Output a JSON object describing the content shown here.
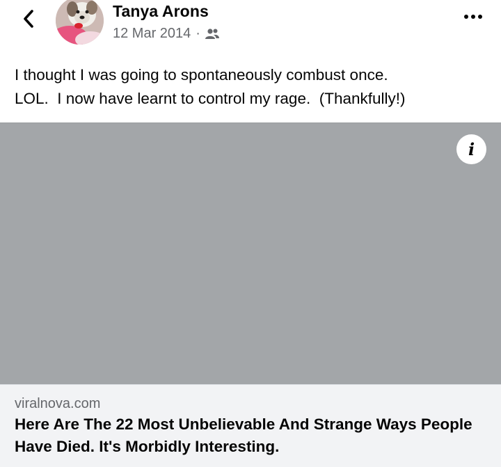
{
  "post": {
    "author": "Tanya Arons",
    "date": "12 Mar 2014",
    "separator": "·",
    "audience_icon": "friends-icon",
    "text": "I thought I was going to spontaneously combust once.\nLOL.  I now have learnt to control my rage.  (Thankfully!)"
  },
  "header": {
    "back_icon": "chevron-left-icon",
    "more_icon": "more-horizontal-icon"
  },
  "link_preview": {
    "info_label": "i",
    "domain": "viralnova.com",
    "title": "Here Are The 22 Most Unbelievable And Strange Ways People Have Died. It's Morbidly Interesting."
  },
  "colors": {
    "image_placeholder": "#a3a6a9",
    "card_background": "#f2f3f5",
    "secondary_text": "#65676b",
    "primary_text": "#050505"
  }
}
